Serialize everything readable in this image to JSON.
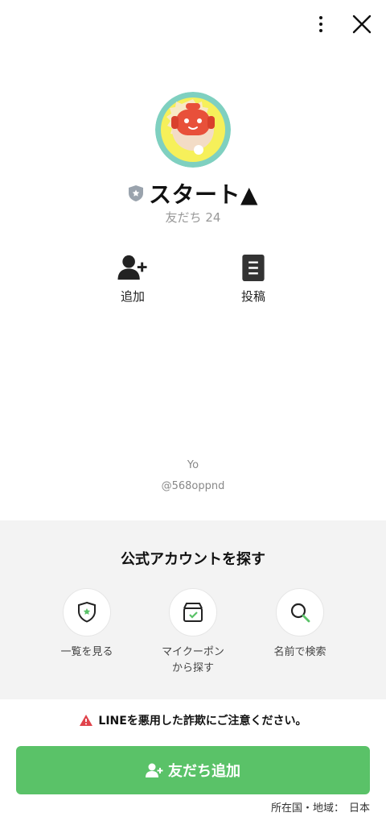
{
  "header": {
    "menu_icon": "more-vertical-icon",
    "close_icon": "close-icon"
  },
  "profile": {
    "name": "スタート▲",
    "friends_label": "友だち",
    "friends_count": "24",
    "badge_icon": "shield-badge-icon",
    "avatar": "robot-avatar"
  },
  "actions": [
    {
      "label": "追加",
      "icon": "add-friend-icon"
    },
    {
      "label": "投稿",
      "icon": "post-icon"
    }
  ],
  "description": "Yo",
  "handle": "@568oppnd",
  "explore": {
    "title": "公式アカウントを探す",
    "items": [
      {
        "label": "一覧を見る",
        "icon": "shield-star-icon"
      },
      {
        "label": "マイクーポン\nから探す",
        "label_line1": "マイクーポン",
        "label_line2": "から探す",
        "icon": "coupon-box-icon"
      },
      {
        "label": "名前で検索",
        "icon": "search-icon"
      }
    ]
  },
  "warning": {
    "text": "LINEを悪用した詐欺にご注意ください。",
    "icon": "warning-icon"
  },
  "cta": {
    "label": "友だち追加",
    "icon": "add-friend-icon"
  },
  "region": {
    "label": "所在国・地域：",
    "value": "日本"
  },
  "colors": {
    "accent": "#5ac268",
    "warning": "#e0434b",
    "section_bg": "#f3f3f3"
  }
}
